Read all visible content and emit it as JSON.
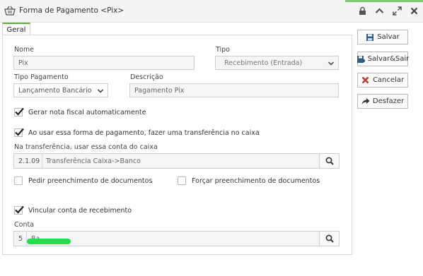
{
  "window": {
    "title": "Forma de Pagamento <Pix>",
    "icons": [
      "basket-icon",
      "lock-icon",
      "chevron-up-icon",
      "expand-icon",
      "close-icon"
    ]
  },
  "tabs": [
    {
      "label": "Geral",
      "active": true
    }
  ],
  "form": {
    "nome": {
      "label": "Nome",
      "value": "Pix"
    },
    "tipo": {
      "label": "Tipo",
      "value": "Recebimento (Entrada)"
    },
    "tipo_pagamento": {
      "label": "Tipo Pagamento",
      "value": "Lançamento Bancário"
    },
    "descricao": {
      "label": "Descrição",
      "value": "Pagamento Pix"
    },
    "gerar_nota": {
      "label": "Gerar nota fiscal automaticamente",
      "checked": true
    },
    "transferencia": {
      "label": "Ao usar essa forma de pagamento, fazer uma transferência no caixa",
      "checked": true
    },
    "conta_caixa": {
      "label": "Na transferência, usar essa conta do caixa",
      "code": "2.1.09",
      "description": "Transferência Caixa->Banco"
    },
    "pedir_docs": {
      "label": "Pedir preenchimento de documentos",
      "checked": false
    },
    "forcar_docs": {
      "label": "Forçar preenchimento de documentos",
      "checked": false
    },
    "vincular": {
      "label": "Vincular conta de recebimento",
      "checked": true
    },
    "conta": {
      "label": "Conta",
      "code": "5",
      "description": "Ba"
    }
  },
  "actions": {
    "salvar": "Salvar",
    "salvar_sair": "Salvar&Sair",
    "cancelar": "Cancelar",
    "desfazer": "Desfazer"
  },
  "colors": {
    "accent_green": "#6aa84f",
    "cancel_red": "#c0392b",
    "save_blue": "#2e5d8a"
  }
}
